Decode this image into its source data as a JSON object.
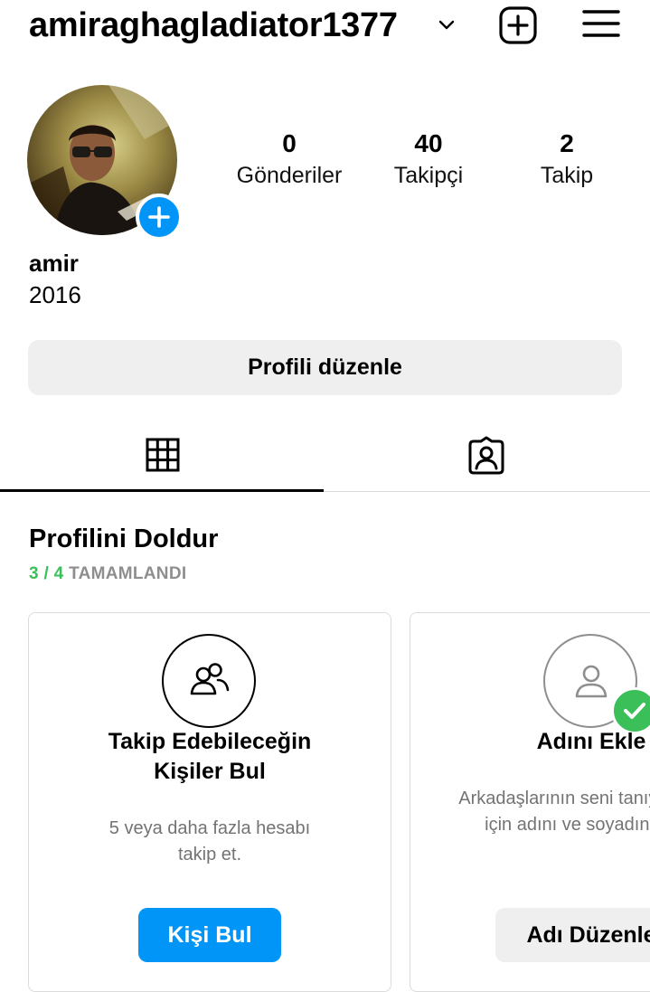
{
  "header": {
    "username": "amiraghagladiator1377"
  },
  "profile": {
    "display_name": "amir",
    "bio": "2016",
    "stats": [
      {
        "value": "0",
        "label": "Gönderiler"
      },
      {
        "value": "40",
        "label": "Takipçi"
      },
      {
        "value": "2",
        "label": "Takip"
      }
    ],
    "edit_button": "Profili düzenle"
  },
  "tabs": [
    {
      "icon": "grid-icon",
      "active": true
    },
    {
      "icon": "tagged-icon",
      "active": false
    }
  ],
  "completion": {
    "title": "Profilini Doldur",
    "progress_count": "3 / 4",
    "progress_label": "TAMAMLANDI",
    "cards": [
      {
        "icon": "people-icon",
        "title_line1": "Takip Edebileceğin",
        "title_line2": "Kişiler Bul",
        "desc_line1": "5 veya daha fazla hesabı",
        "desc_line2": "takip et.",
        "button": "Kişi Bul",
        "completed": false
      },
      {
        "icon": "person-icon",
        "title_line1": "Adını Ekle",
        "desc_line1": "Arkadaşlarının seni tanıyabilmesi",
        "desc_line2": "için adını ve soyadını ekle.",
        "button": "Adı Düzenle",
        "completed": true
      }
    ]
  },
  "colors": {
    "accent": "#0095f6",
    "success": "#3bbf58",
    "secondary_bg": "#efefef",
    "muted_text": "#737373"
  }
}
